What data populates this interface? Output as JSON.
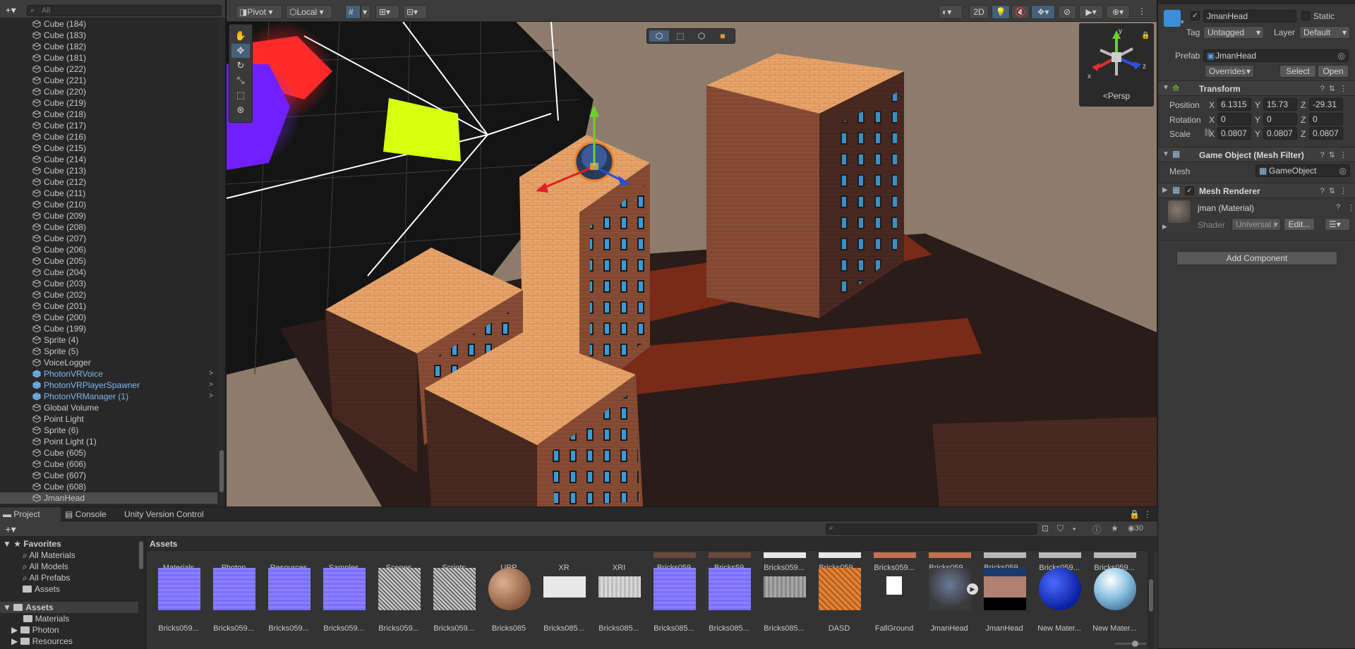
{
  "hierarchy": {
    "search_placeholder": "All",
    "items": [
      {
        "label": "Cube (184)",
        "type": "cube"
      },
      {
        "label": "Cube (183)",
        "type": "cube"
      },
      {
        "label": "Cube (182)",
        "type": "cube"
      },
      {
        "label": "Cube (181)",
        "type": "cube"
      },
      {
        "label": "Cube (222)",
        "type": "cube"
      },
      {
        "label": "Cube (221)",
        "type": "cube"
      },
      {
        "label": "Cube (220)",
        "type": "cube"
      },
      {
        "label": "Cube (219)",
        "type": "cube"
      },
      {
        "label": "Cube (218)",
        "type": "cube"
      },
      {
        "label": "Cube (217)",
        "type": "cube"
      },
      {
        "label": "Cube (216)",
        "type": "cube"
      },
      {
        "label": "Cube (215)",
        "type": "cube"
      },
      {
        "label": "Cube (214)",
        "type": "cube"
      },
      {
        "label": "Cube (213)",
        "type": "cube"
      },
      {
        "label": "Cube (212)",
        "type": "cube"
      },
      {
        "label": "Cube (211)",
        "type": "cube"
      },
      {
        "label": "Cube (210)",
        "type": "cube"
      },
      {
        "label": "Cube (209)",
        "type": "cube"
      },
      {
        "label": "Cube (208)",
        "type": "cube"
      },
      {
        "label": "Cube (207)",
        "type": "cube"
      },
      {
        "label": "Cube (206)",
        "type": "cube"
      },
      {
        "label": "Cube (205)",
        "type": "cube"
      },
      {
        "label": "Cube (204)",
        "type": "cube"
      },
      {
        "label": "Cube (203)",
        "type": "cube"
      },
      {
        "label": "Cube (202)",
        "type": "cube"
      },
      {
        "label": "Cube (201)",
        "type": "cube"
      },
      {
        "label": "Cube (200)",
        "type": "cube"
      },
      {
        "label": "Cube (199)",
        "type": "cube"
      },
      {
        "label": "Sprite (4)",
        "type": "cube"
      },
      {
        "label": "Sprite (5)",
        "type": "cube"
      },
      {
        "label": "VoiceLogger",
        "type": "cube"
      },
      {
        "label": "PhotonVRVoice",
        "type": "prefab"
      },
      {
        "label": "PhotonVRPlayerSpawner",
        "type": "prefab"
      },
      {
        "label": "PhotonVRManager (1)",
        "type": "prefab"
      },
      {
        "label": "Global Volume",
        "type": "cube"
      },
      {
        "label": "Point Light",
        "type": "cube"
      },
      {
        "label": "Sprite (6)",
        "type": "cube"
      },
      {
        "label": "Point Light (1)",
        "type": "cube"
      },
      {
        "label": "Cube (605)",
        "type": "cube"
      },
      {
        "label": "Cube (606)",
        "type": "cube"
      },
      {
        "label": "Cube (607)",
        "type": "cube"
      },
      {
        "label": "Cube (608)",
        "type": "cube"
      },
      {
        "label": "JmanHead",
        "type": "cube",
        "selected": true
      }
    ]
  },
  "scene_toolbar": {
    "pivot": "Pivot",
    "local": "Local",
    "mode_2d": "2D",
    "gizmo_view": "Persp",
    "gizmo_axes": {
      "x": "x",
      "y": "y",
      "z": "z"
    }
  },
  "inspector": {
    "object_name": "JmanHead",
    "static_label": "Static",
    "tag_label": "Tag",
    "tag_value": "Untagged",
    "layer_label": "Layer",
    "layer_value": "Default",
    "prefab_label": "Prefab",
    "prefab_value": "JmanHead",
    "overrides": "Overrides",
    "select_btn": "Select",
    "open_btn": "Open",
    "transform": {
      "title": "Transform",
      "position_label": "Position",
      "rotation_label": "Rotation",
      "scale_label": "Scale",
      "axis_x": "X",
      "axis_y": "Y",
      "axis_z": "Z",
      "position": [
        "6.1315",
        "15.73",
        "-29.31"
      ],
      "rotation": [
        "0",
        "0",
        "0"
      ],
      "scale": [
        "0.0807",
        "0.0807",
        "0.0807"
      ]
    },
    "mesh_filter": {
      "title": "Game Object (Mesh Filter)",
      "mesh_label": "Mesh",
      "mesh_value": "GameObject"
    },
    "mesh_renderer": {
      "title": "Mesh Renderer"
    },
    "material": {
      "name": "jman (Material)",
      "shader_label": "Shader",
      "shader_value": "Universal I",
      "edit_btn": "Edit..."
    },
    "add_component": "Add Component"
  },
  "bottom": {
    "tabs": [
      "Project",
      "Console",
      "Unity Version Control"
    ],
    "count": "30",
    "favorites": {
      "title": "Favorites",
      "items": [
        "All Materials",
        "All Models",
        "All Prefabs",
        "Assets"
      ]
    },
    "assets_tree": {
      "title": "Assets",
      "items": [
        "Materials",
        "Photon",
        "Resources"
      ]
    },
    "assets_header": "Assets",
    "row1": [
      "Materials",
      "Photon",
      "Resources",
      "Samples",
      "Scenes",
      "Scripts",
      "URP",
      "XR",
      "XRI",
      "Bricks059",
      "Bricks59",
      "Bricks059...",
      "Bricks059...",
      "Bricks059...",
      "Bricks059...",
      "Bricks059...",
      "Bricks059...",
      "Bricks059..."
    ],
    "row2": [
      {
        "label": "Bricks059...",
        "kind": "normal"
      },
      {
        "label": "Bricks059...",
        "kind": "normal"
      },
      {
        "label": "Bricks059...",
        "kind": "normal"
      },
      {
        "label": "Bricks059...",
        "kind": "normal"
      },
      {
        "label": "Bricks059...",
        "kind": "gray"
      },
      {
        "label": "Bricks059...",
        "kind": "gray"
      },
      {
        "label": "Bricks085",
        "kind": "sphere-brick"
      },
      {
        "label": "Bricks085...",
        "kind": "white"
      },
      {
        "label": "Bricks085...",
        "kind": "lightgray"
      },
      {
        "label": "Bricks085...",
        "kind": "normal"
      },
      {
        "label": "Bricks085...",
        "kind": "normal"
      },
      {
        "label": "Bricks085...",
        "kind": "midgray"
      },
      {
        "label": "DASD",
        "kind": "orange"
      },
      {
        "label": "FallGround",
        "kind": "file"
      },
      {
        "label": "JmanHead",
        "kind": "head"
      },
      {
        "label": "JmanHead",
        "kind": "headtex"
      },
      {
        "label": "New Mater...",
        "kind": "bluesphere"
      },
      {
        "label": "New Mater...",
        "kind": "glasssphere"
      }
    ]
  }
}
